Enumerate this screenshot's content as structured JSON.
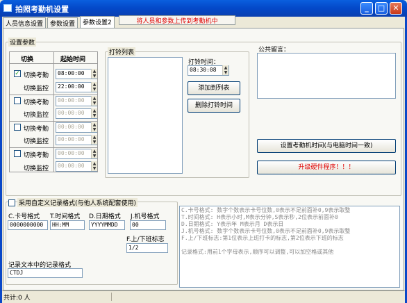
{
  "window": {
    "title": "拍照考勤机设置"
  },
  "tabs": [
    {
      "label": "人员信息设置"
    },
    {
      "label": "参数设置"
    },
    {
      "label": "参数设置2"
    }
  ],
  "upload_button": "将人员和参数上传到考勤机中",
  "settings": {
    "group_label": "设置参数",
    "col_switch": "切换",
    "col_start": "起始时间",
    "rows": [
      {
        "a_label": "切换考勤",
        "a_time": "08:00:00",
        "a_checked": true,
        "b_label": "切换监控",
        "b_time": "22:00:00"
      },
      {
        "a_label": "切换考勤",
        "a_time": "00:00:00",
        "a_checked": false,
        "b_label": "切换监控",
        "b_time": "00:00:00"
      },
      {
        "a_label": "切换考勤",
        "a_time": "00:00:00",
        "a_checked": false,
        "b_label": "切换监控",
        "b_time": "00:00:00"
      },
      {
        "a_label": "切换考勤",
        "a_time": "00:00:00",
        "a_checked": false,
        "b_label": "切换监控",
        "b_time": "00:00:00"
      }
    ]
  },
  "bell": {
    "list_label": "打铃列表",
    "time_label": "打铃时间：",
    "time_value": "08:30:08",
    "add_button": "添加到列表",
    "delete_button": "删除打铃时间"
  },
  "notice": {
    "label": "公共留言：",
    "value": ""
  },
  "set_time_button": "设置考勤机时间(与电脑时间一致)",
  "upgrade_button": "升级硬件程序！！！",
  "custom": {
    "checkbox_label": "采用自定义记录格式(与他人系统配套使用)",
    "card_label": "C.卡号格式",
    "card_value": "0000000000",
    "time_label": "T.时间格式",
    "time_value": "HH:MM",
    "date_label": "D.日期格式",
    "date_value": "YYYYMMDD",
    "machine_label": "J.机号格式",
    "machine_value": "00",
    "updown_label": "F.上/下班标志",
    "updown_value": "1/2",
    "record_label": "记录文本中的记录格式",
    "record_value": "CTDJ",
    "help_lines": [
      "C.卡号格式: 数字个数表示卡号位数,0表示不足前面补0,9表示取整",
      "T.时间格式: H表示小时,M表示分钟,S表示秒,2位表示前面补0",
      "D.日期格式: Y表示年   M表示月   D表示日",
      "J.机号格式: 数字个数表示卡号位数,0表示不足前面补0,9表示取整",
      "F.上/下班标志:第1位表示上班打卡的标志,第2位表示下班的标志",
      "",
      "记录格式:用前1个字母表示,顺序可以调整,可以加空格或其他"
    ]
  },
  "status": {
    "text": "共计:0 人"
  }
}
